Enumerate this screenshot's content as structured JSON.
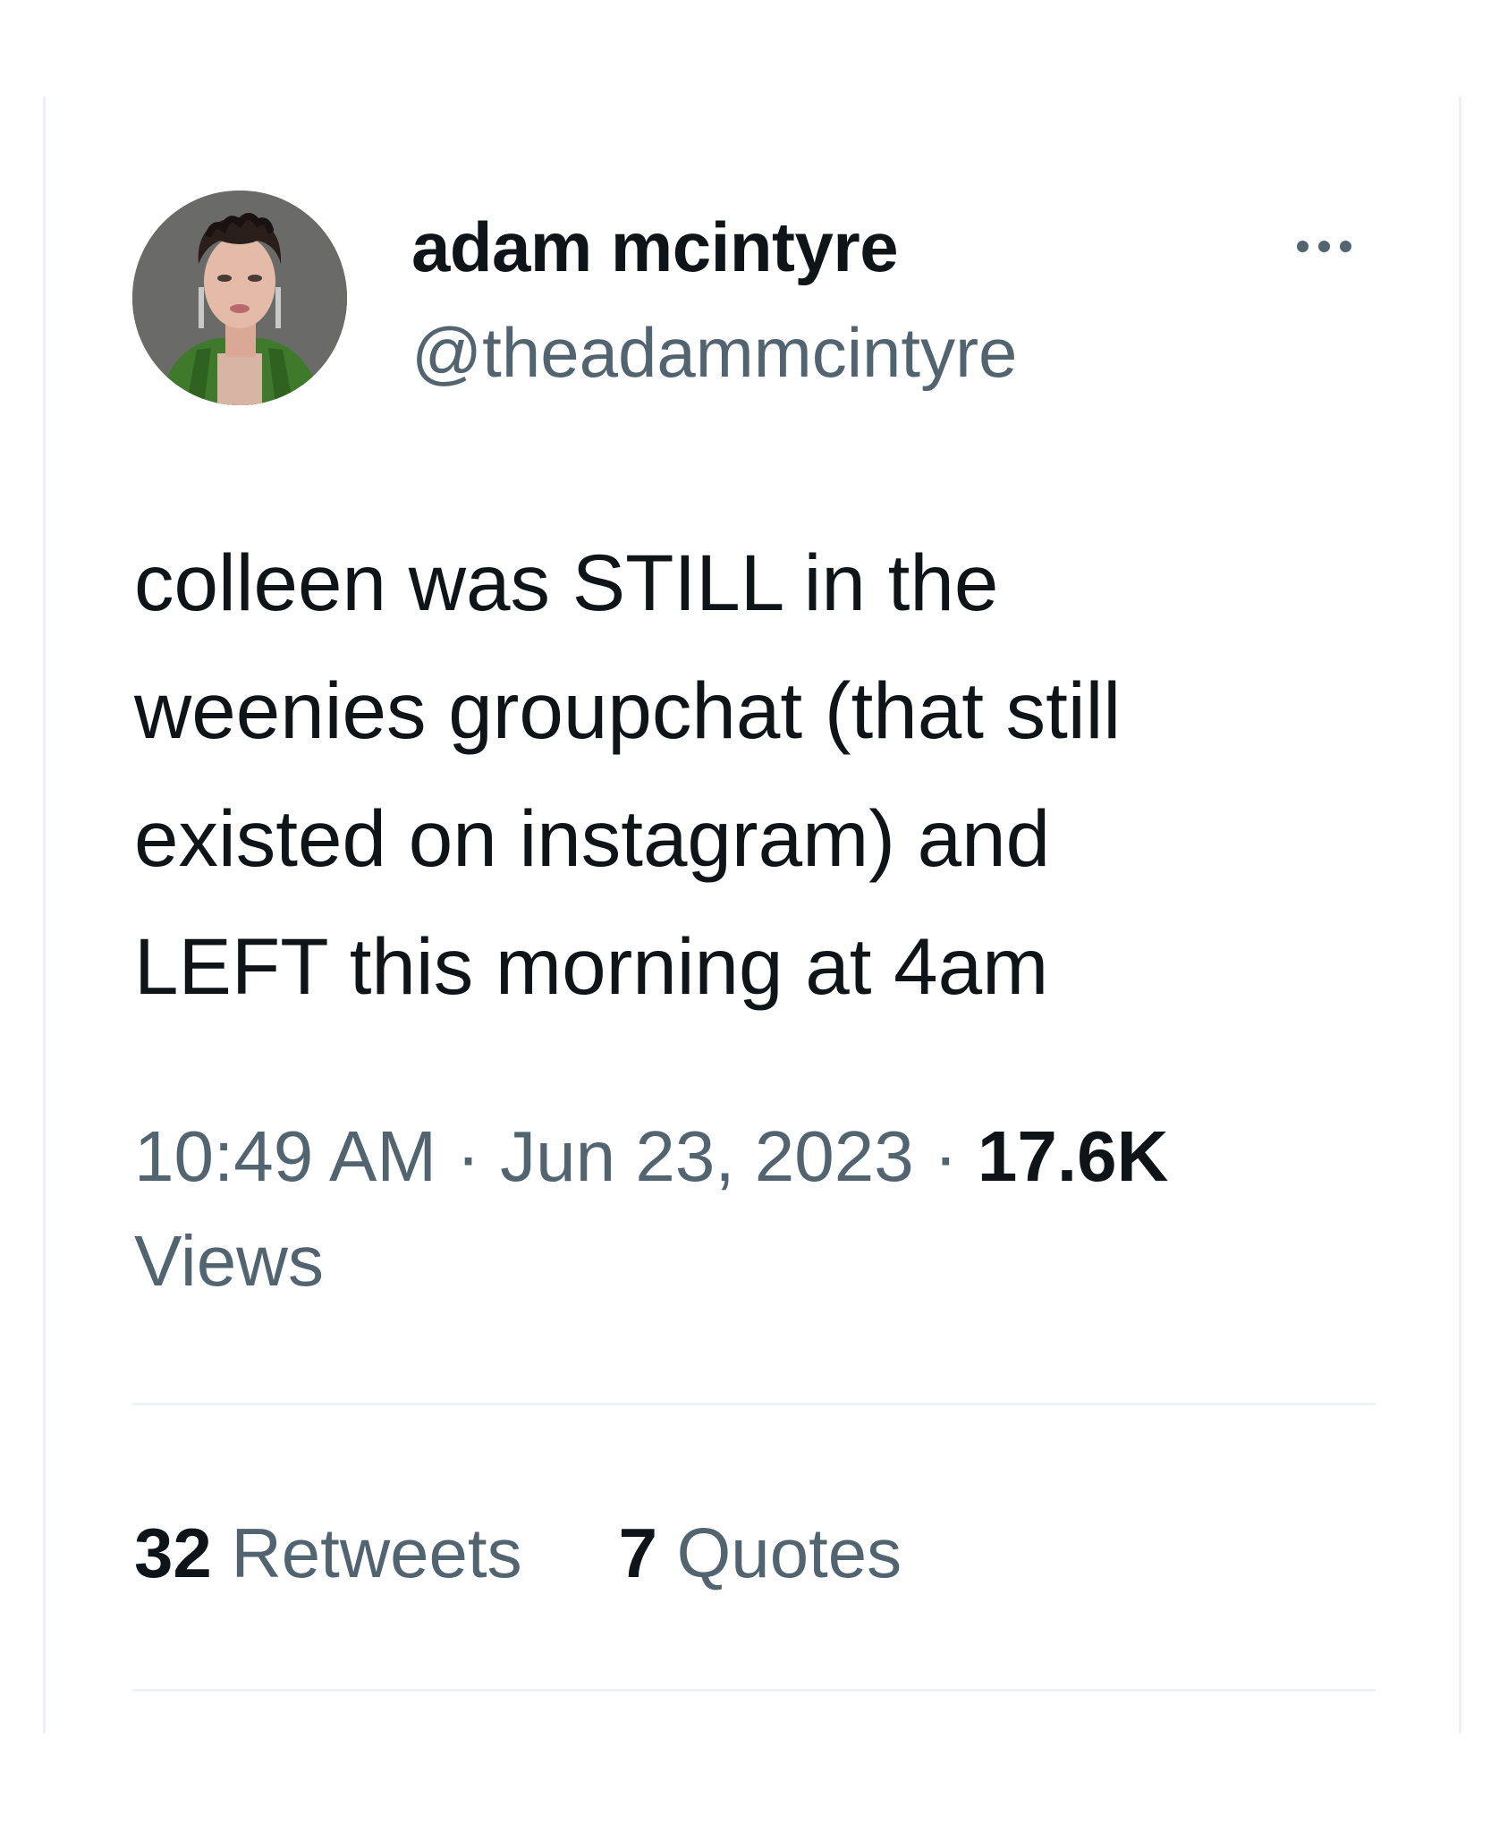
{
  "tweet": {
    "author": {
      "display_name": "adam mcintyre",
      "handle": "@theadammcintyre",
      "avatar_icon": "profile-photo"
    },
    "more_icon": "ellipsis-icon",
    "text": "colleen was STILL in the\nweenies groupchat (that still\nexisted on instagram) and\nLEFT this morning at 4am",
    "time": "10:49 AM",
    "separator": "·",
    "date": "Jun 23, 2023",
    "views_count": "17.6K",
    "views_label": "Views",
    "stats": [
      {
        "count": "32",
        "label": "Retweets"
      },
      {
        "count": "7",
        "label": "Quotes"
      }
    ]
  },
  "colors": {
    "text_primary": "#0f1419",
    "text_secondary": "#536471",
    "divider": "#eff3f4"
  }
}
